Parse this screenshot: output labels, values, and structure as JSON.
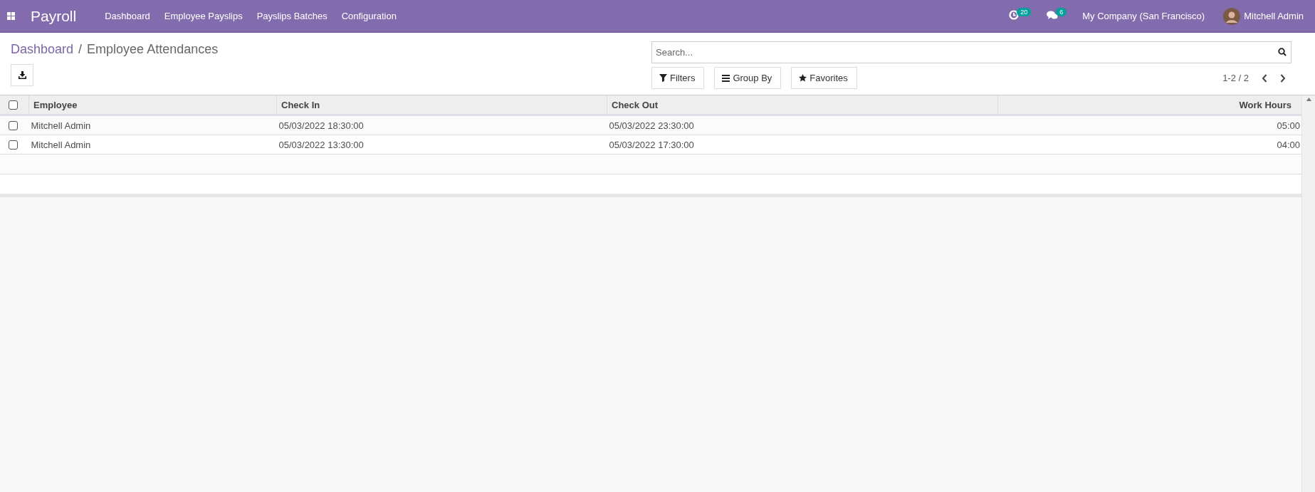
{
  "navbar": {
    "app_title": "Payroll",
    "menu": [
      "Dashboard",
      "Employee Payslips",
      "Payslips Batches",
      "Configuration"
    ],
    "activity_count": "20",
    "message_count": "6",
    "company": "My Company (San Francisco)",
    "user": "Mitchell Admin"
  },
  "breadcrumb": {
    "parent": "Dashboard",
    "separator": "/",
    "current": "Employee Attendances"
  },
  "search": {
    "placeholder": "Search..."
  },
  "search_buttons": [
    "Filters",
    "Group By",
    "Favorites"
  ],
  "pager": "1-2 / 2",
  "table": {
    "select_all_checked": false,
    "columns": [
      {
        "label": "Employee",
        "kind": "text"
      },
      {
        "label": "Check In",
        "kind": "text"
      },
      {
        "label": "Check Out",
        "kind": "text"
      },
      {
        "label": "Work Hours",
        "kind": "number"
      }
    ],
    "rows": [
      {
        "checked": false,
        "cells": [
          "Mitchell Admin",
          "05/03/2022 18:30:00",
          "05/03/2022 23:30:00",
          "05:00"
        ]
      },
      {
        "checked": false,
        "cells": [
          "Mitchell Admin",
          "05/03/2022 13:30:00",
          "05/03/2022 17:30:00",
          "04:00"
        ]
      }
    ]
  }
}
